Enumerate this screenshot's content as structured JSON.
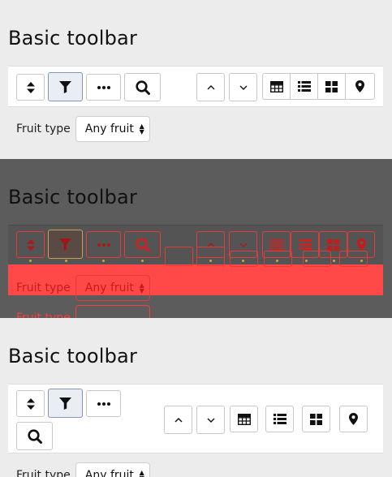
{
  "panels": [
    {
      "title": "Basic toolbar",
      "fruit_label": "Fruit type",
      "fruit_select_value": "Any fruit"
    },
    {
      "title": "Basic toolbar",
      "fruit_label": "Fruit type",
      "fruit_select_value": "Any fruit",
      "fruit_label_2": "Fruit type"
    },
    {
      "title": "Basic toolbar",
      "fruit_label": "Fruit type",
      "fruit_select_value": "Any fruit"
    }
  ],
  "icons": {
    "sort": "sort-icon",
    "filter": "filter-icon",
    "more": "ellipsis-icon",
    "search": "search-icon",
    "up": "chevron-up-icon",
    "down": "chevron-down-icon",
    "table": "table-icon",
    "list": "list-icon",
    "grid": "grid-icon",
    "map": "map-marker-icon"
  },
  "colors": {
    "active_border": "#7e98bd",
    "overlay_red": "#ff4848",
    "overlay_dark": "#5c5c5c"
  }
}
